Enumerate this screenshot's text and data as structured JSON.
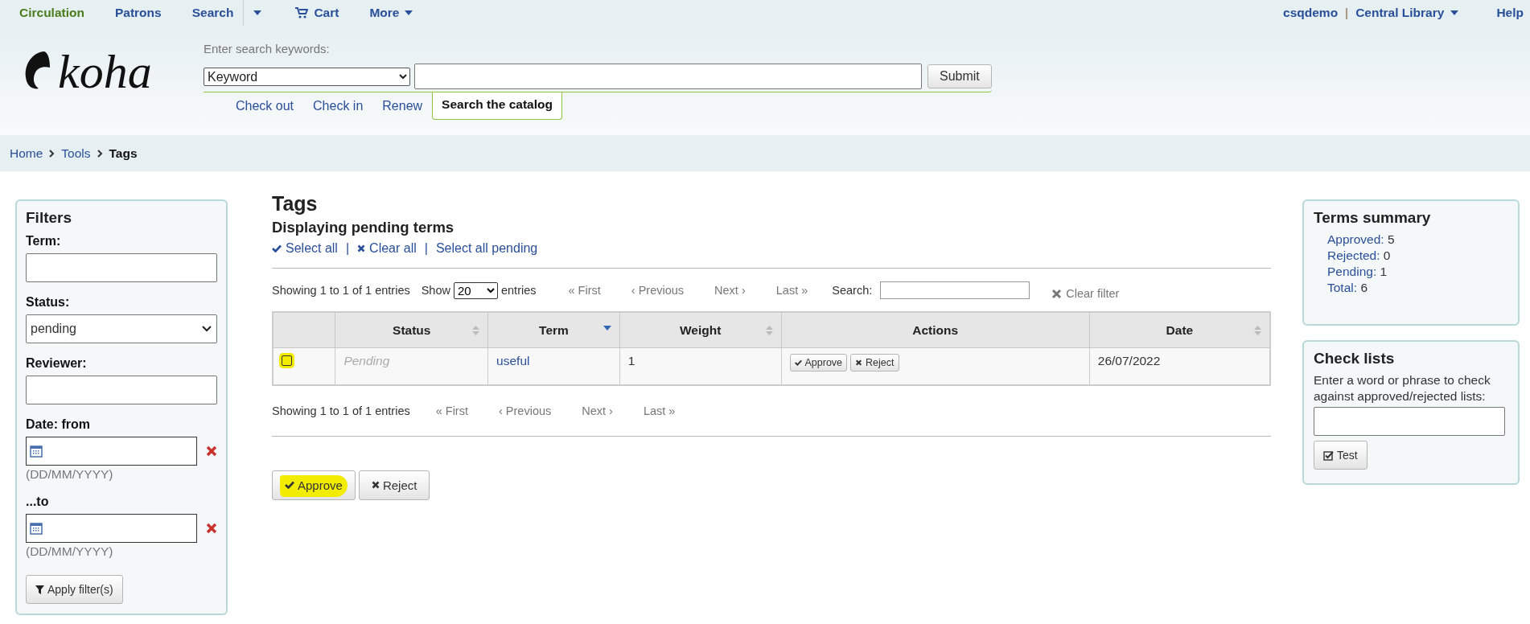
{
  "top_nav": {
    "items": [
      {
        "label": "Circulation",
        "kind": "plain",
        "selected": true
      },
      {
        "label": "Patrons",
        "kind": "plain",
        "selected": false
      },
      {
        "label": "Search",
        "kind": "split",
        "selected": false
      },
      {
        "label": "Cart",
        "kind": "cart",
        "selected": false
      },
      {
        "label": "More",
        "kind": "menu",
        "selected": false
      }
    ],
    "user": "csqdemo",
    "separator": "|",
    "library": "Central Library",
    "help": "Help"
  },
  "header": {
    "logo": "koha",
    "search_label": "Enter search keywords:",
    "search_type": "Keyword",
    "submit": "Submit",
    "tabs": [
      {
        "label": "Check out",
        "selected": false
      },
      {
        "label": "Check in",
        "selected": false
      },
      {
        "label": "Renew",
        "selected": false
      },
      {
        "label": "Search the catalog",
        "selected": true
      }
    ]
  },
  "breadcrumbs": [
    {
      "label": "Home",
      "current": false
    },
    {
      "label": "Tools",
      "current": false
    },
    {
      "label": "Tags",
      "current": true
    }
  ],
  "filters": {
    "title": "Filters",
    "fields": [
      {
        "label": "Term:",
        "kind": "text"
      },
      {
        "label": "Status:",
        "kind": "select",
        "value": "pending"
      },
      {
        "label": "Reviewer:",
        "kind": "text"
      },
      {
        "label": "Date: from",
        "kind": "date",
        "hint": "(DD/MM/YYYY)"
      },
      {
        "label": "...to",
        "kind": "date",
        "hint": "(DD/MM/YYYY)"
      }
    ],
    "apply_button": "Apply filter(s)"
  },
  "main": {
    "title": "Tags",
    "subtitle": "Displaying pending terms",
    "separator": "|",
    "select_links": [
      {
        "label": "Select all",
        "kind": "select"
      },
      {
        "label": "Clear all",
        "kind": "clear"
      },
      {
        "label": "Select all pending",
        "kind": "plain"
      }
    ]
  },
  "table_top": {
    "info": "Showing 1 to 1 of 1 entries",
    "show_label": "Show",
    "page_size": "20",
    "entries_label": "entries",
    "pager": [
      "« First",
      "‹ Previous",
      "Next ›",
      "Last »"
    ],
    "search_label": "Search:",
    "clear_filter": "Clear filter"
  },
  "table": {
    "columns": [
      {
        "label": "Status",
        "kind": "sortable"
      },
      {
        "label": "Term",
        "kind": "sorted"
      },
      {
        "label": "Weight",
        "kind": "sortable"
      },
      {
        "label": "Actions",
        "kind": "plain"
      },
      {
        "label": "Date",
        "kind": "sortable"
      }
    ],
    "rows": [
      {
        "checked": false,
        "highlighted": true,
        "status": "Pending",
        "term": "useful",
        "weight": "1",
        "actions": [
          "Approve",
          "Reject"
        ],
        "date": "26/07/2022"
      }
    ]
  },
  "table_bottom": {
    "info": "Showing 1 to 1 of 1 entries",
    "pager": [
      "« First",
      "‹ Previous",
      "Next ›",
      "Last »"
    ]
  },
  "bottom_buttons": [
    {
      "label": "Approve",
      "kind": "approve",
      "highlighted": true
    },
    {
      "label": "Reject",
      "kind": "reject",
      "highlighted": false
    }
  ],
  "terms_summary": {
    "title": "Terms summary",
    "items": [
      {
        "label": "Approved:",
        "count": "5"
      },
      {
        "label": "Rejected:",
        "count": "0"
      },
      {
        "label": "Pending:",
        "count": "1"
      },
      {
        "label": "Total:",
        "count": "6"
      }
    ]
  },
  "check_lists": {
    "title": "Check lists",
    "text": "Enter a word or phrase to check against approved/rejected lists:",
    "button": "Test"
  }
}
